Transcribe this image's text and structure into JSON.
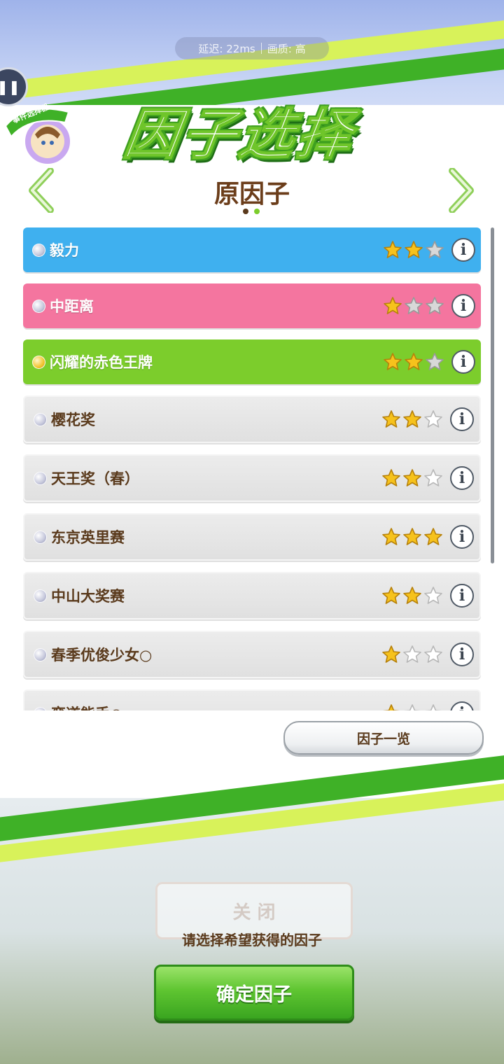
{
  "overlay": {
    "latency_text": "延迟: 22ms",
    "overlay_extra": "画质: 高"
  },
  "header": {
    "title": "因子选择",
    "subtitle": "原因子",
    "event_badge_text": "事件选择器"
  },
  "factors": [
    {
      "label": "毅力",
      "stars": 2,
      "max_stars": 3,
      "style": "blue",
      "bullet": "silver"
    },
    {
      "label": "中距离",
      "stars": 1,
      "max_stars": 3,
      "style": "pink",
      "bullet": "silver"
    },
    {
      "label": "闪耀的赤色王牌",
      "stars": 2,
      "max_stars": 3,
      "style": "green",
      "bullet": "gold"
    },
    {
      "label": "樱花奖",
      "stars": 2,
      "max_stars": 3,
      "style": "gray",
      "bullet": "silver"
    },
    {
      "label": "天王奖（春）",
      "stars": 2,
      "max_stars": 3,
      "style": "gray",
      "bullet": "silver"
    },
    {
      "label": "东京英里赛",
      "stars": 3,
      "max_stars": 3,
      "style": "gray",
      "bullet": "silver"
    },
    {
      "label": "中山大奖赛",
      "stars": 2,
      "max_stars": 3,
      "style": "gray",
      "bullet": "silver"
    },
    {
      "label": "春季优俊少女○",
      "stars": 1,
      "max_stars": 3,
      "style": "gray",
      "bullet": "silver"
    },
    {
      "label": "弯道能手○",
      "stars": 1,
      "max_stars": 3,
      "style": "gray",
      "bullet": "silver"
    }
  ],
  "buttons": {
    "factor_list": "因子一览",
    "faded": "关 闭",
    "confirm": "确定因子"
  },
  "hint": "请选择希望获得的因子",
  "colors": {
    "blue": "#3fb0ef",
    "pink": "#f4759f",
    "green": "#7ccd2c",
    "gray": "#e3e3e3",
    "text_dark": "#5a3a1c",
    "accent_green": "#5fc531"
  }
}
